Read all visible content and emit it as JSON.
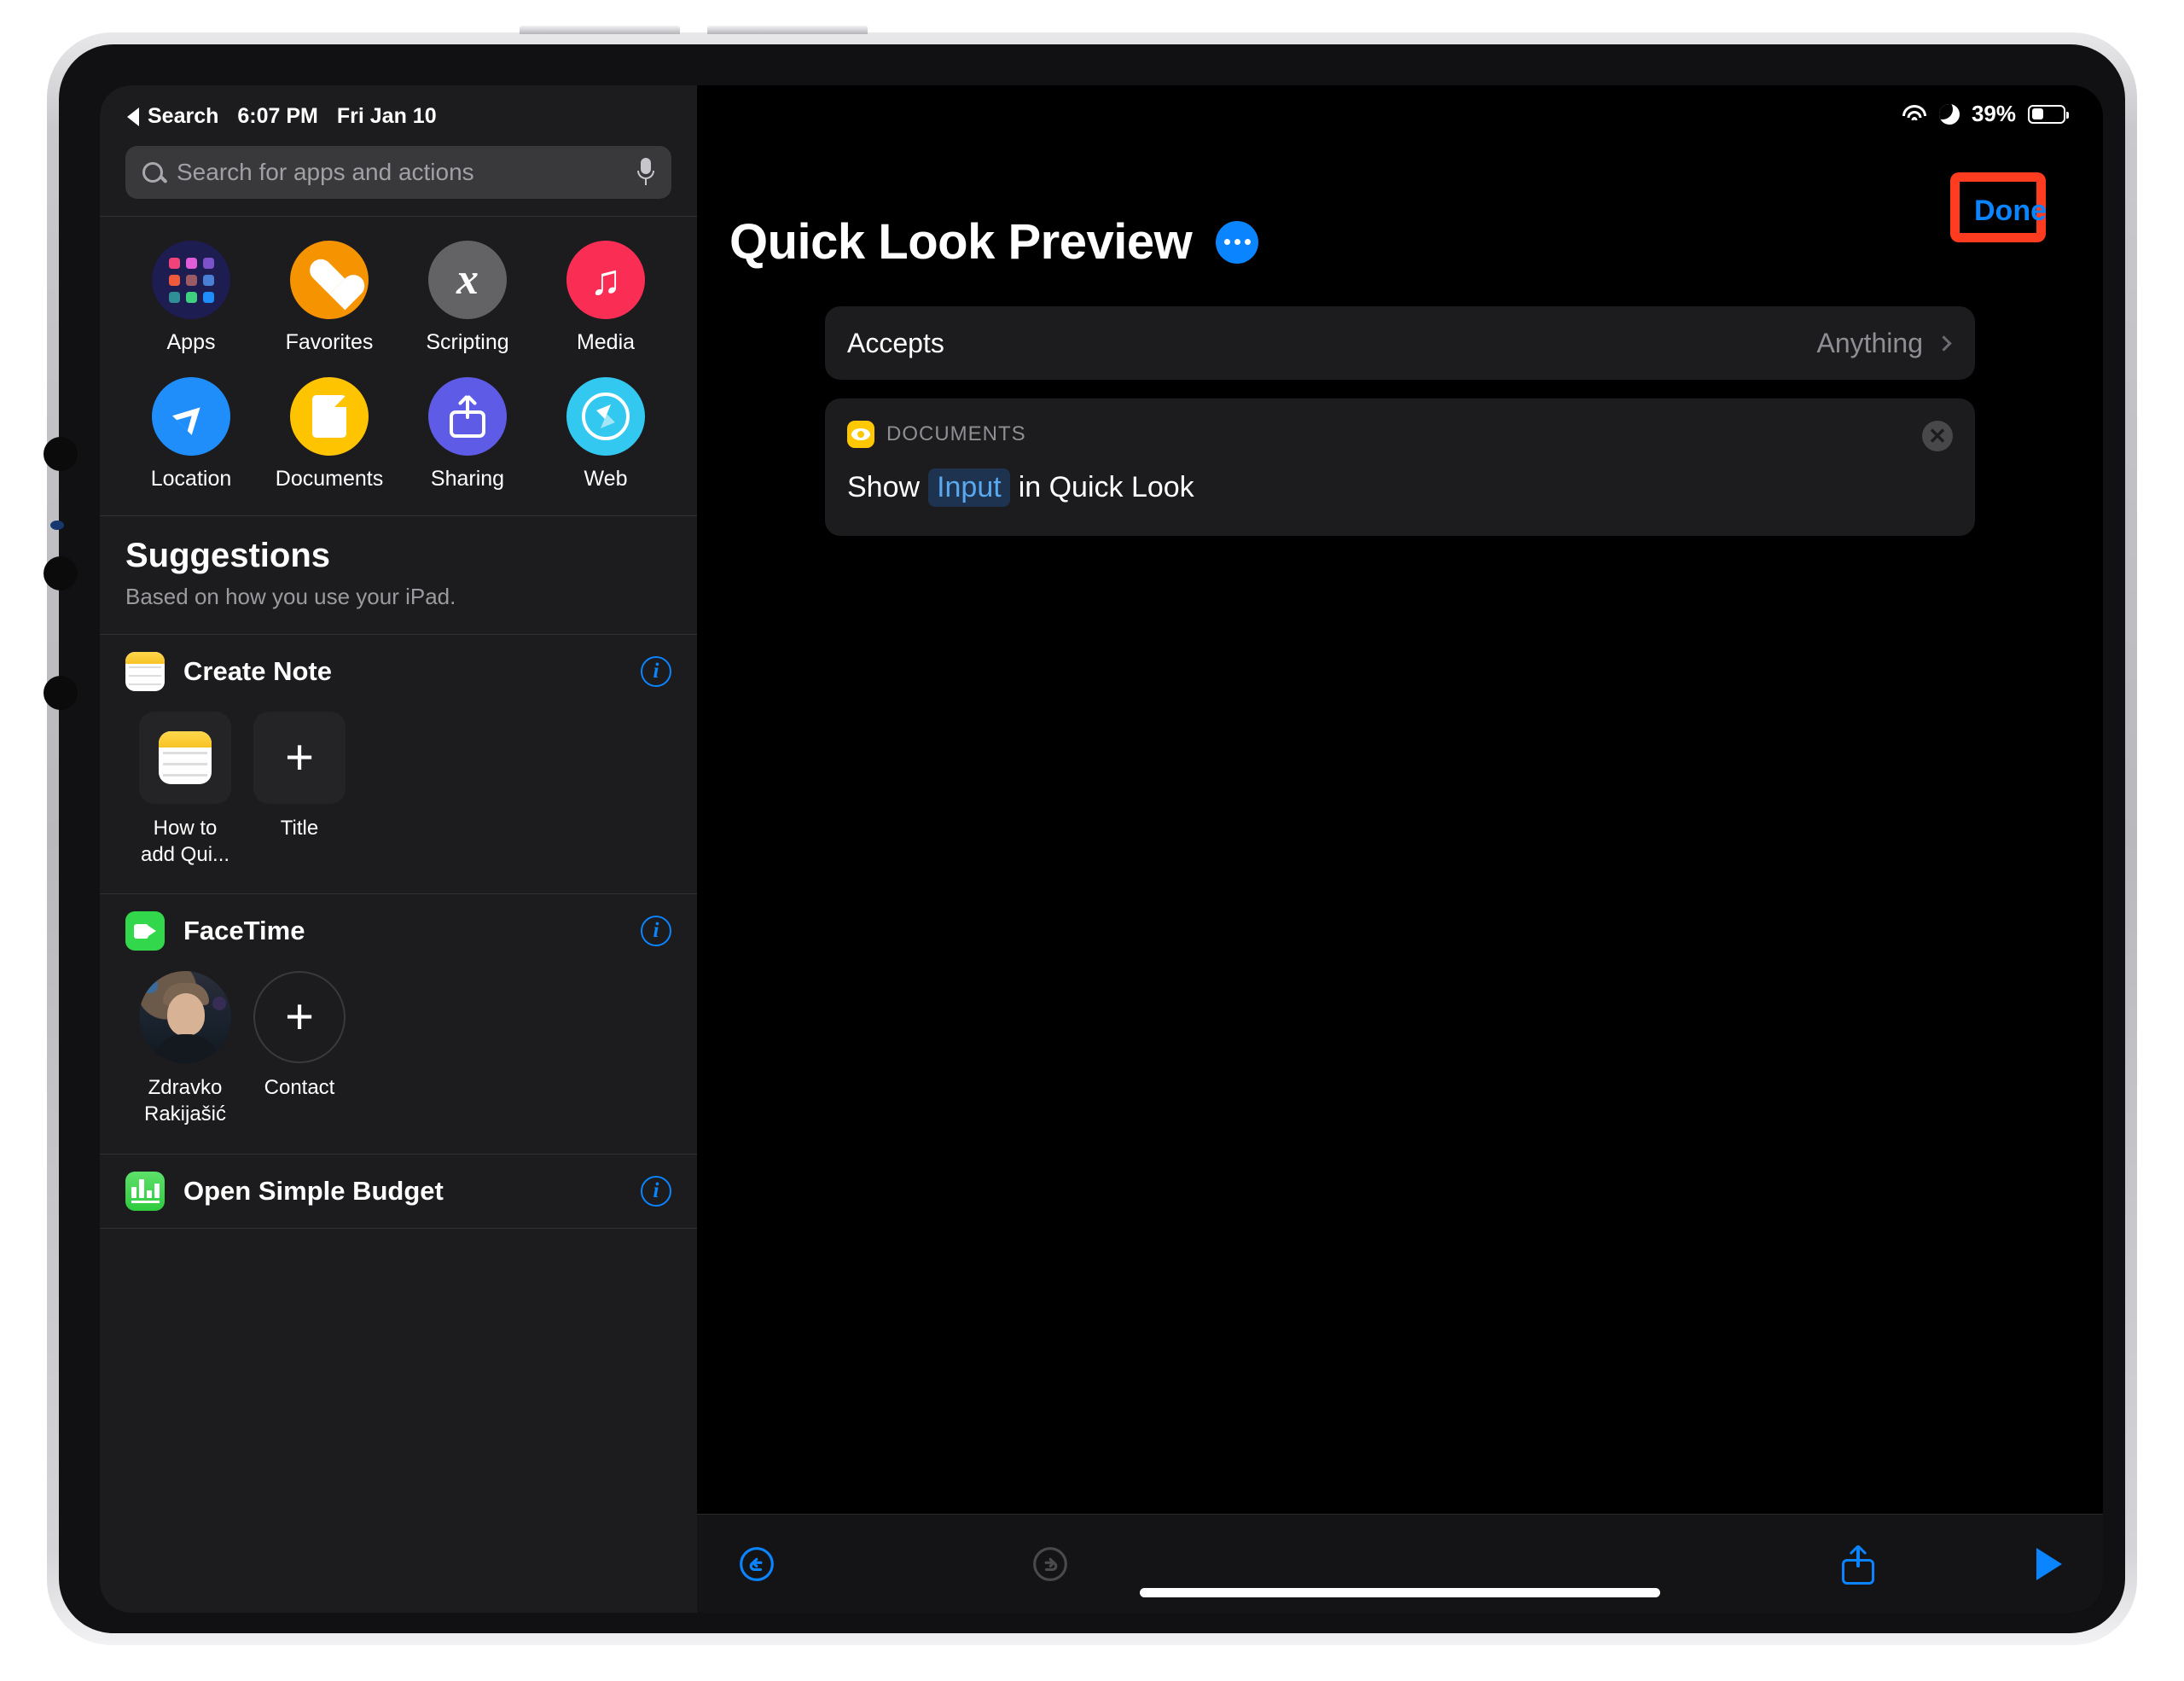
{
  "device": {
    "name": "iPad Pro"
  },
  "status_bar": {
    "left": {
      "back_label": "Search",
      "time": "6:07 PM",
      "date": "Fri Jan 10"
    },
    "right": {
      "wifi_icon": "wifi-icon",
      "dnd_icon": "moon-icon",
      "battery_percent": "39%",
      "battery_level": 39
    }
  },
  "sidebar": {
    "search": {
      "placeholder": "Search for apps and actions",
      "value": "",
      "search_icon": "search-icon",
      "mic_icon": "microphone-icon"
    },
    "categories": [
      {
        "label": "Apps",
        "icon": "apps-grid-icon",
        "bg": "#1d1d52"
      },
      {
        "label": "Favorites",
        "icon": "heart-icon",
        "bg": "#f59300"
      },
      {
        "label": "Scripting",
        "icon": "x-variable-icon",
        "bg": "#636366"
      },
      {
        "label": "Media",
        "icon": "music-note-icon",
        "bg": "#fa2d55"
      },
      {
        "label": "Location",
        "icon": "navigation-arrow-icon",
        "bg": "#1f8dfa"
      },
      {
        "label": "Documents",
        "icon": "document-icon",
        "bg": "#ffc400"
      },
      {
        "label": "Sharing",
        "icon": "share-icon",
        "bg": "#5e5ce6"
      },
      {
        "label": "Web",
        "icon": "compass-icon",
        "bg": "#32c8f0"
      }
    ],
    "suggestions": {
      "title": "Suggestions",
      "subtitle": "Based on how you use your iPad.",
      "sections": [
        {
          "name": "Create Note",
          "icon": "notes-app-icon",
          "info_icon": "info-icon",
          "tiles": [
            {
              "label": "How to add Qui...",
              "icon": "notes-app-icon",
              "shape": "square"
            },
            {
              "label": "Title",
              "icon": "plus-icon",
              "shape": "square"
            }
          ]
        },
        {
          "name": "FaceTime",
          "icon": "facetime-app-icon",
          "info_icon": "info-icon",
          "tiles": [
            {
              "label": "Zdravko Rakijašić",
              "icon": "contact-avatar",
              "shape": "circle"
            },
            {
              "label": "Contact",
              "icon": "plus-icon",
              "shape": "circle"
            }
          ]
        },
        {
          "name": "Open Simple Budget",
          "icon": "numbers-app-icon",
          "info_icon": "info-icon",
          "tiles": []
        }
      ]
    }
  },
  "detail": {
    "done_label": "Done",
    "highlight_color": "#ff3b20",
    "accent_color": "#0a84ff",
    "title": "Quick Look Preview",
    "more_icon": "ellipsis-badge-icon",
    "accepts": {
      "label": "Accepts",
      "value": "Anything",
      "chevron_icon": "chevron-right-icon"
    },
    "action": {
      "category": "DOCUMENTS",
      "category_icon": "eye-icon",
      "close_icon": "close-icon",
      "text_before": "Show",
      "token": "Input",
      "text_after": "in Quick Look"
    },
    "toolbar": {
      "undo_icon": "undo-icon",
      "redo_icon": "redo-icon",
      "share_icon": "share-icon",
      "run_icon": "play-icon"
    }
  }
}
